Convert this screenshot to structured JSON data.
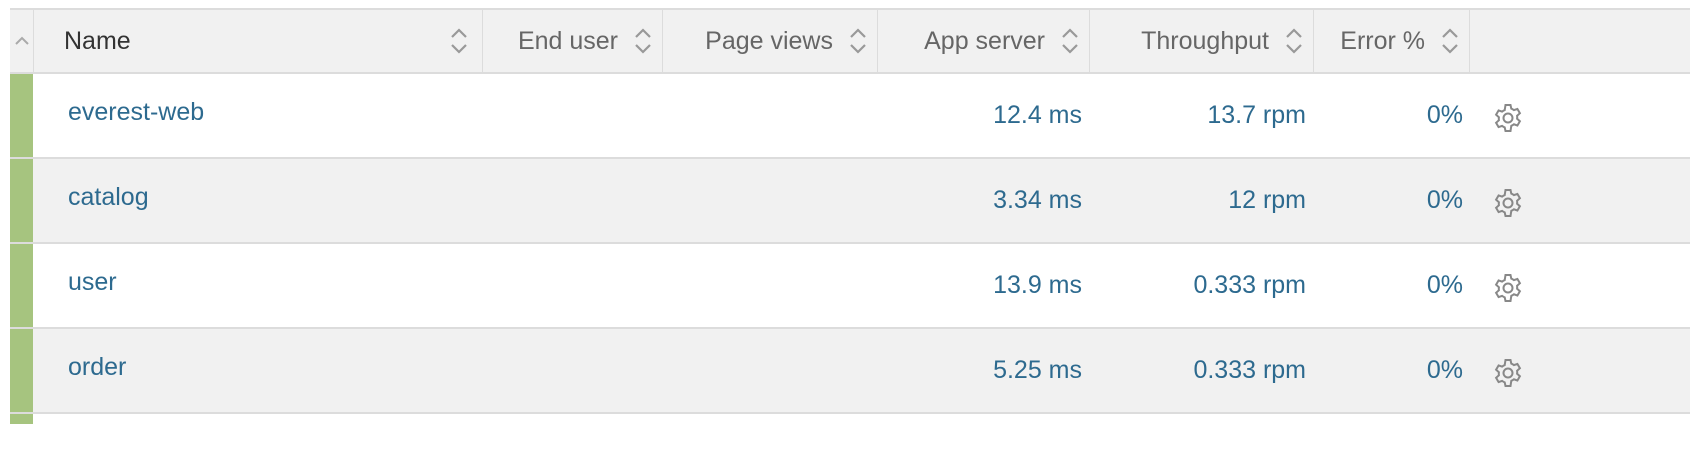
{
  "table": {
    "columns": [
      {
        "key": "toggle",
        "label": ""
      },
      {
        "key": "name",
        "label": "Name"
      },
      {
        "key": "end_user",
        "label": "End user"
      },
      {
        "key": "page_views",
        "label": "Page views"
      },
      {
        "key": "app_server",
        "label": "App server"
      },
      {
        "key": "throughput",
        "label": "Throughput"
      },
      {
        "key": "error_pct",
        "label": "Error %"
      }
    ],
    "rows": [
      {
        "name": "everest-web",
        "app_server": "12.4 ms",
        "throughput": "13.7 rpm",
        "error_pct": "0%"
      },
      {
        "name": "catalog",
        "app_server": "3.34 ms",
        "throughput": "12 rpm",
        "error_pct": "0%"
      },
      {
        "name": "user",
        "app_server": "13.9 ms",
        "throughput": "0.333 rpm",
        "error_pct": "0%"
      },
      {
        "name": "order",
        "app_server": "5.25 ms",
        "throughput": "0.333 rpm",
        "error_pct": "0%"
      }
    ]
  },
  "colors": {
    "status_bar": "#a6c47f",
    "link": "#2d6a8f",
    "header_bg": "#f1f1f1",
    "border": "#dcdcdc"
  },
  "icons": {
    "collapse": "chevron-up-icon",
    "sort": "sort-icon",
    "settings": "gear-icon"
  }
}
